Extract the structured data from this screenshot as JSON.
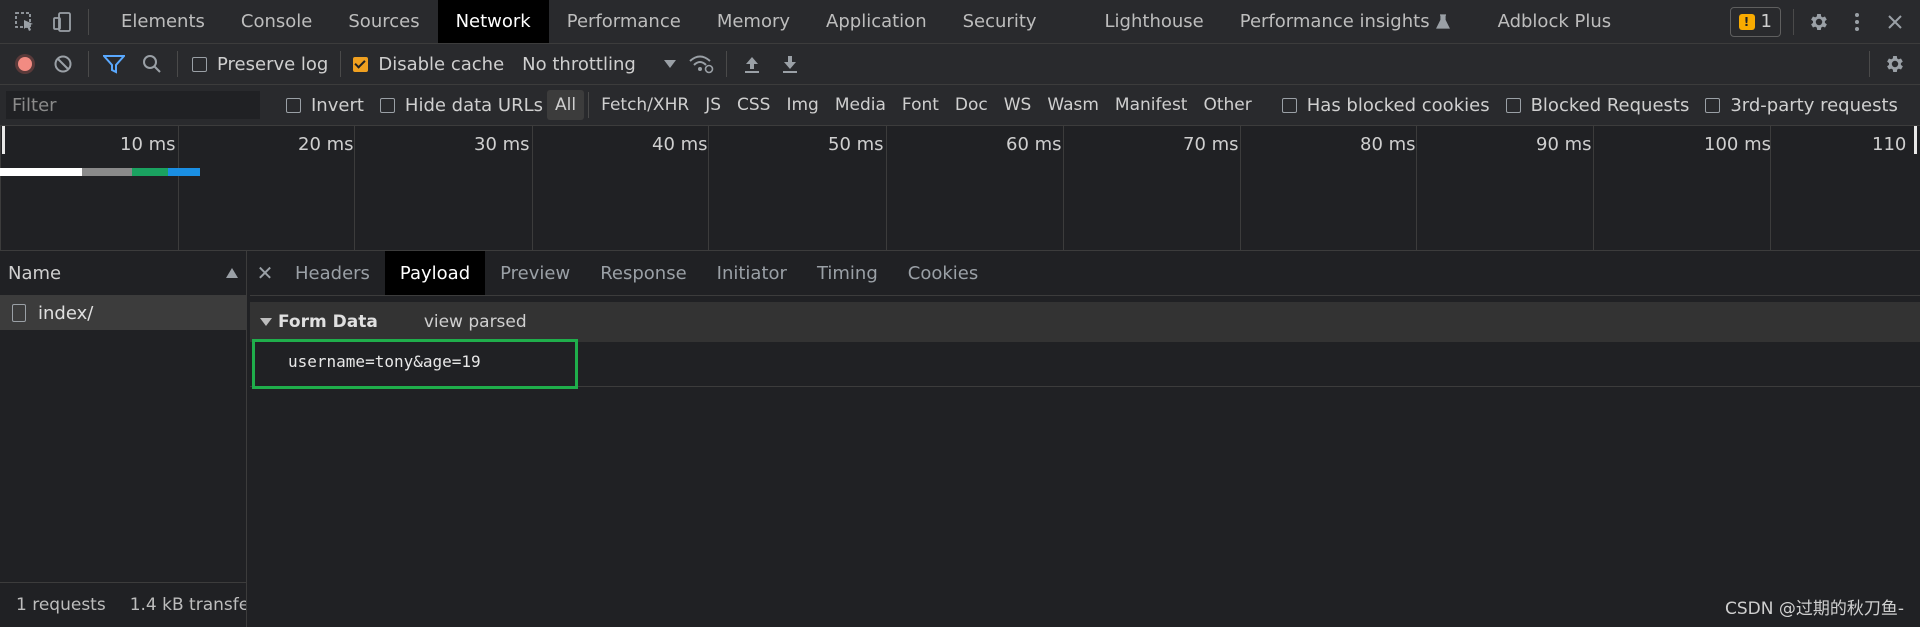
{
  "main_tabs": [
    "Elements",
    "Console",
    "Sources",
    "Network",
    "Performance",
    "Memory",
    "Application",
    "Security",
    "Lighthouse",
    "Performance insights",
    "Adblock Plus"
  ],
  "active_main_tab": "Network",
  "issues_count": "1",
  "toolbar": {
    "preserve_log": "Preserve log",
    "disable_cache": "Disable cache",
    "throttling": "No throttling"
  },
  "filter": {
    "placeholder": "Filter",
    "invert": "Invert",
    "hide_data_urls": "Hide data URLs",
    "types": [
      "All",
      "Fetch/XHR",
      "JS",
      "CSS",
      "Img",
      "Media",
      "Font",
      "Doc",
      "WS",
      "Wasm",
      "Manifest",
      "Other"
    ],
    "selected_type": "All",
    "has_blocked_cookies": "Has blocked cookies",
    "blocked_requests": "Blocked Requests",
    "third_party": "3rd-party requests"
  },
  "timeline": {
    "labels": [
      "10 ms",
      "20 ms",
      "30 ms",
      "40 ms",
      "50 ms",
      "60 ms",
      "70 ms",
      "80 ms",
      "90 ms",
      "100 ms",
      "110"
    ]
  },
  "request_list": {
    "header": "Name",
    "rows": [
      "index/"
    ],
    "footer_requests": "1 requests",
    "footer_transfer": "1.4 kB transfe"
  },
  "detail_tabs": [
    "Headers",
    "Payload",
    "Preview",
    "Response",
    "Initiator",
    "Timing",
    "Cookies"
  ],
  "active_detail_tab": "Payload",
  "payload": {
    "section_title": "Form Data",
    "view_parsed": "view parsed",
    "raw": "username=tony&age=19"
  },
  "watermark": "CSDN @过期的秋刀鱼-",
  "colors": {
    "background": "#202124",
    "toolbar": "#292a2d",
    "highlight_box": "#1fae4b",
    "record": "#f28b82",
    "checkbox_checked": "#f0a020"
  }
}
